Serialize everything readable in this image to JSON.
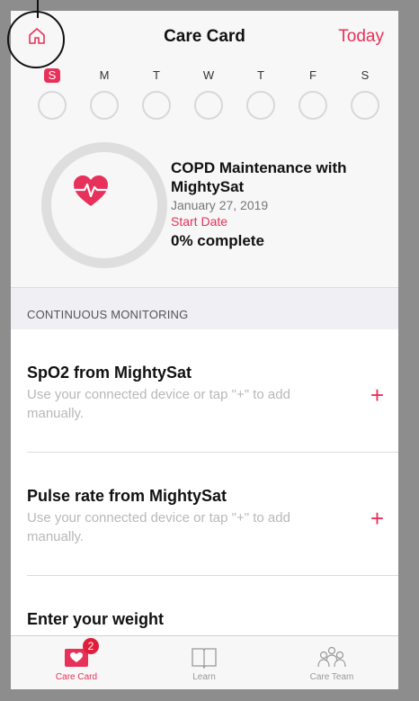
{
  "header": {
    "title": "Care Card",
    "today_label": "Today"
  },
  "week": {
    "days": [
      "S",
      "M",
      "T",
      "W",
      "T",
      "F",
      "S"
    ],
    "selected_index": 0
  },
  "summary": {
    "plan_title": "COPD Maintenance with MightySat",
    "date": "January 27, 2019",
    "start_label": "Start Date",
    "complete": "0% complete"
  },
  "section": {
    "title": "CONTINUOUS MONITORING"
  },
  "items": [
    {
      "title": "SpO2 from MightySat",
      "subtitle": "Use your connected device or tap \"+\" to add manually.",
      "action": "+"
    },
    {
      "title": "Pulse rate from MightySat",
      "subtitle": "Use your connected device or tap \"+\" to add manually.",
      "action": "+"
    },
    {
      "title": "Enter your weight",
      "subtitle": "",
      "action": "+"
    }
  ],
  "tabbar": {
    "tabs": [
      {
        "label": "Care Card",
        "badge": "2",
        "icon": "care-card-icon"
      },
      {
        "label": "Learn",
        "icon": "book-icon"
      },
      {
        "label": "Care Team",
        "icon": "people-icon"
      }
    ]
  },
  "colors": {
    "accent": "#e8315a",
    "ring": "#dedede",
    "background": "#f7f7f7"
  }
}
